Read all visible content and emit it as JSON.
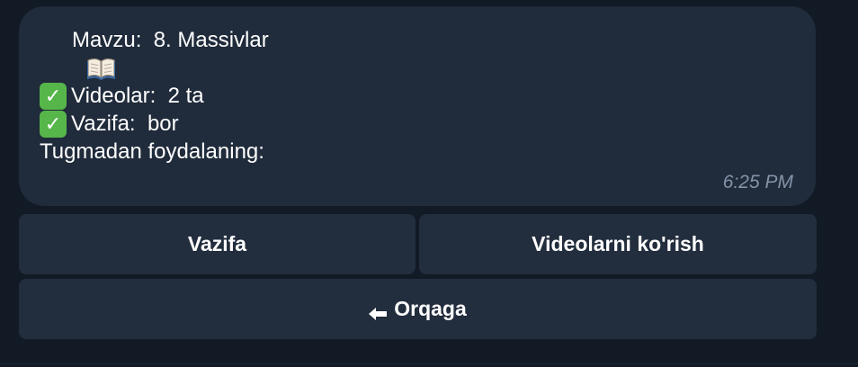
{
  "message": {
    "topic_prefix": "Mavzu:  ",
    "topic_value": "8. Massivlar",
    "videos_label": "Videolar:  ",
    "videos_value": "2 ta",
    "task_label": "Vazifa:  ",
    "task_value": "bor",
    "prompt": "Tugmadan foydalaning:",
    "time": "6:25 PM",
    "book_icon": "open-book-emoji",
    "check_icon": "check-mark-button-emoji",
    "check_color": "#56b64a"
  },
  "keyboard": {
    "row1": {
      "left_label": "Vazifa",
      "right_label": "Videolarni ko'rish"
    },
    "row2": {
      "back_label": "Orqaga",
      "back_icon": "left-arrow-icon"
    }
  },
  "colors": {
    "background": "#111a25",
    "bubble": "#202b3b",
    "button": "#222d3d",
    "time_text": "#8493a8"
  }
}
